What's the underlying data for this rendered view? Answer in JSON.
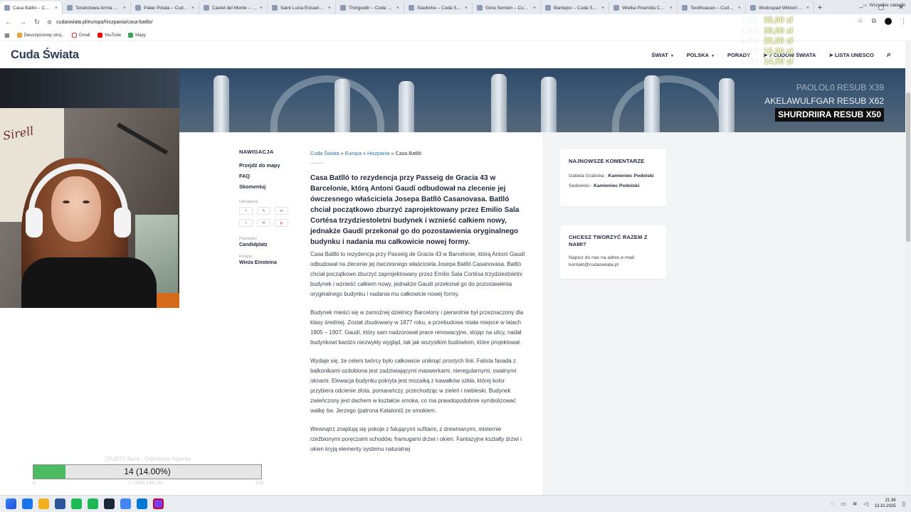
{
  "browser": {
    "tabs": [
      {
        "label": "Casa Batlló – Cuda Świata",
        "active": true
      },
      {
        "label": "Terakotowa Armia – Cuda"
      },
      {
        "label": "Pałac Potala – Cuda Ś"
      },
      {
        "label": "Castel del Monte – Cu"
      },
      {
        "label": "Saint Lucia Estuarium"
      },
      {
        "label": "Thingvellir – Cuda Świa"
      },
      {
        "label": "Stavkirke – Cuda Świat"
      },
      {
        "label": "Góra Semien – Cuda Ś"
      },
      {
        "label": "Bardejov – Cuda Świat"
      },
      {
        "label": "Wielka Piramida Cheo"
      },
      {
        "label": "Teotihuacan – Cuda Ś"
      },
      {
        "label": "Wodospad Wiktorii – C"
      }
    ],
    "close_glyph": "×",
    "new_tab_glyph": "+",
    "url": "cudaswiata.pl/europa/hiszpania/casa-batllo/",
    "bookmarks": [
      {
        "label": "Dwuczęściowy stroj...",
        "color": "#e8a23a"
      },
      {
        "label": "Gmail",
        "color": "#ffffff"
      },
      {
        "label": "YouTube",
        "color": "#ff0000"
      },
      {
        "label": "Mapy",
        "color": "#34a853"
      }
    ],
    "all_bookmarks": "Wszystkie zakładki"
  },
  "site": {
    "logo": "Cuda Świata",
    "nav": [
      {
        "label": "ŚWIAT",
        "caret": true
      },
      {
        "label": "POLSKA",
        "caret": true
      },
      {
        "label": "PORADY",
        "caret": false
      },
      {
        "label": "➤ 7 CUDÓW ŚWIATA",
        "caret": false
      },
      {
        "label": "➤ LISTA UNESCO",
        "caret": false
      }
    ]
  },
  "left_nav": {
    "heading": "NAWIGACJA",
    "links": [
      "Przejdź do mapy",
      "FAQ",
      "Skomentuj"
    ],
    "share_label": "Udostępnij",
    "share_icons": [
      "f",
      "𝕏",
      "in",
      "r",
      "✉",
      "p"
    ],
    "prev_label": "Poprzedni",
    "prev_title": "Candidplatz",
    "next_label": "Kolejny",
    "next_title": "Wieża Einsteina"
  },
  "article": {
    "breadcrumb": [
      "Cuda Świata",
      "Europa",
      "Hiszpania",
      "Casa Batlló"
    ],
    "lead": "Casa Batlló to rezydencja przy Passeig de Gracia 43 w Barcelonie, którą Antoni Gaudí odbudował na zlecenie jej ówczesnego właściciela Josepa Batlló Casanovasa. Batlló chciał początkowo zburzyć zaprojektowany przez Emilio Sala Cortésa trzydziestoletni budynek i wznieść całkiem nowy, jednakże Gaudí przekonał go do pozostawienia oryginalnego budynku i nadania mu całkowicie nowej formy.",
    "paragraphs": [
      "Casa Batlló to rezydencja przy Passeig de Gracia 43 w Barcelonie, którą Antoni Gaudí odbudował na zlecenie jej ówczesnego właściciela Josepa Batlló Casanovasa. Batlló chciał początkowo zburzyć zaprojektowany przez Emilio Sala Cortésa trzydziestoletni budynek i wznieść całkiem nowy, jednakże Gaudí przekonał go do pozostawienia oryginalnego budynku i nadania mu całkowicie nowej formy.",
      "Budynek mieści się w zamożnej dzielnicy Barcelony i pierwotnie był przeznaczony dla klasy średniej. Został zbudowany w 1877 roku, a przebudowa miała miejsce w latach 1905 – 1907. Gaudí, który sam nadzorował prace renowacyjne, stojąc na ulicy, nadał budynkowi bardzo niezwykły wygląd, tak jak wszystkim budowlom, które projektował.",
      "Wydaje się, że celem twórcy było całkowicie uniknąć prostych linii. Falista fasada z balkonikami ozdobiona jest zadziwiającymi maswerkami, nieregularnymi, owalnymi oknami. Elewacja budynku pokryta jest mozaiką z kawałków szkła, której kolor przybiera odcienie złota, pomarańczy, przechodząc w zieleń i niebieski. Budynek zwieńczony jest dachem w kształcie smoka, co ma prawdopodobnie symbolizować walkę św. Jerzego (patrona Katalonii) ze smokiem.",
      "Wewnątrz znajdują się pokoje z falującymi sufitami, z drewnianymi, misternie rzeźbionymi poręczami schodów, framugami drzwi i okien. Fantazyjne kształty drzwi i okien kryją elementy systemu naturalnej"
    ]
  },
  "sidebar": {
    "comments_title": "NAJNOWSZE KOMENTARZE",
    "comments": [
      {
        "author": "Izabela Grabska",
        "sep": " - ",
        "post": "Kamieniec Podolski"
      },
      {
        "author": "Sedowski",
        "sep": " - ",
        "post": "Kamieniec Podolski"
      }
    ],
    "collab_title": "CHCESZ TWORZYĆ RAZEM Z NAMI?",
    "collab_text": "Napisz do nas na adres e-mail: kontakt@cudaswiata.pl"
  },
  "overlay": {
    "donations": [
      {
        "rank": "1.(B)",
        "amount": "35,00 zł"
      },
      {
        "rank": "2.(O)",
        "amount": "30,00 zł"
      },
      {
        "rank": "3.(R)",
        "amount": "25,00 zł"
      },
      {
        "rank": "4.(O)",
        "amount": "15,00 zł"
      },
      {
        "rank": "5.(A)",
        "amount": "14,50 zł"
      }
    ],
    "subs": [
      {
        "text": "PAOLOL0  RESUB X39",
        "highlight": false
      },
      {
        "text": "AKELAWULFGAR  RESUB X62",
        "highlight": false
      },
      {
        "text": "SHURDRIIRA  RESUB X50",
        "highlight": true
      }
    ],
    "goal": {
      "title": "[SUBY] Sara - Odbitowe Agenta",
      "display": "14 (14.00%)",
      "progress": 0.14,
      "min": "0",
      "mid": "17.00/0.14/0.33",
      "max": "100"
    },
    "webcam_text": "Sirell"
  },
  "taskbar": {
    "apps": [
      "#1a73e8",
      "#f2b01e",
      "#2b579a",
      "#1db954",
      "#1db954",
      "#1b2838",
      "#4285f4",
      "#0078d4",
      "#7a3ff0"
    ],
    "time": "21:36",
    "date": "13.10.2025"
  },
  "colors": {
    "brand": "#2d3b55",
    "link": "#2d6fa8",
    "progress": "#4cbb62",
    "sidebar_bg": "#f3f4f6"
  }
}
